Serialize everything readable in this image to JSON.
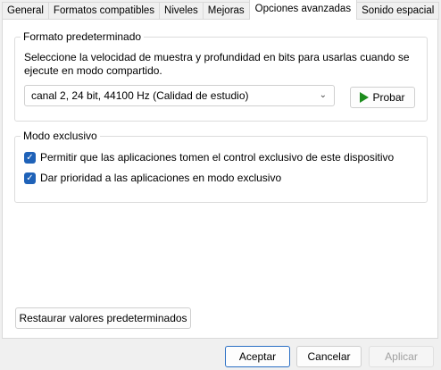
{
  "tabs": [
    {
      "label": "General"
    },
    {
      "label": "Formatos compatibles"
    },
    {
      "label": "Niveles"
    },
    {
      "label": "Mejoras"
    },
    {
      "label": "Opciones avanzadas",
      "active": true
    },
    {
      "label": "Sonido espacial"
    }
  ],
  "default_format": {
    "title": "Formato predeterminado",
    "description": "Seleccione la velocidad de muestra y profundidad en bits para usarlas cuando se ejecute en modo compartido.",
    "selected": "canal 2, 24 bit, 44100 Hz (Calidad de estudio)",
    "test_label": "Probar"
  },
  "exclusive_mode": {
    "title": "Modo exclusivo",
    "allow_label": "Permitir que las aplicaciones tomen el control exclusivo de este dispositivo",
    "priority_label": "Dar prioridad a las aplicaciones en modo exclusivo",
    "allow_checked": true,
    "priority_checked": true
  },
  "restore_label": "Restaurar valores predeterminados",
  "footer": {
    "ok_label": "Aceptar",
    "cancel_label": "Cancelar",
    "apply_label": "Aplicar"
  },
  "colors": {
    "accent": "#1f62b8",
    "play_icon": "#1c8c1c"
  }
}
